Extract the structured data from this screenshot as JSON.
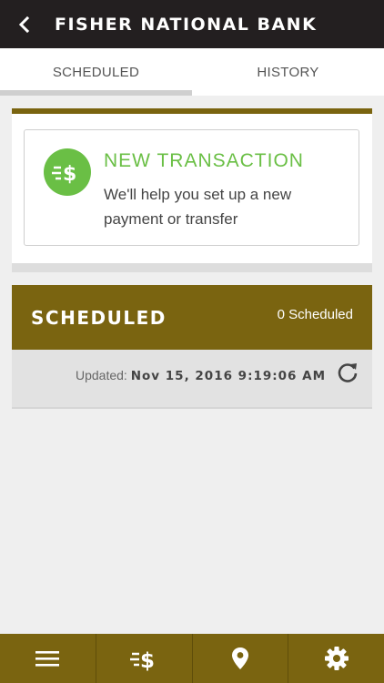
{
  "header": {
    "title": "FISHER NATIONAL BANK",
    "back_icon": "chevron-left-icon"
  },
  "tabs": [
    {
      "label": "SCHEDULED",
      "active": true
    },
    {
      "label": "HISTORY",
      "active": false
    }
  ],
  "new_transaction": {
    "title": "NEW TRANSACTION",
    "description": "We'll help you set up a new payment or transfer",
    "icon": "transfer-dollar-icon"
  },
  "scheduled": {
    "title": "SCHEDULED",
    "count_label": "0 Scheduled",
    "updated_label": "Updated: ",
    "updated_value": "Nov 15, 2016 9:19:06 AM",
    "refresh_icon": "refresh-icon"
  },
  "bottom_nav": [
    {
      "icon": "menu-icon"
    },
    {
      "icon": "transfer-dollar-icon"
    },
    {
      "icon": "location-pin-icon"
    },
    {
      "icon": "gear-icon"
    }
  ],
  "colors": {
    "header_bg": "#231f20",
    "accent_gold": "#7a6410",
    "green": "#6abf45"
  }
}
